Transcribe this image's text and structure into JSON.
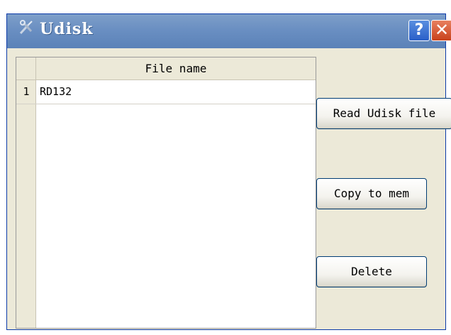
{
  "window": {
    "title": "Udisk",
    "help_label": "?",
    "close_label": "✕"
  },
  "table": {
    "columns": [
      "File name"
    ],
    "rows": [
      {
        "index": "1",
        "file_name": "RD132"
      }
    ]
  },
  "actions": {
    "read_label": "Read Udisk file",
    "copy_label": "Copy to mem",
    "delete_label": "Delete"
  }
}
